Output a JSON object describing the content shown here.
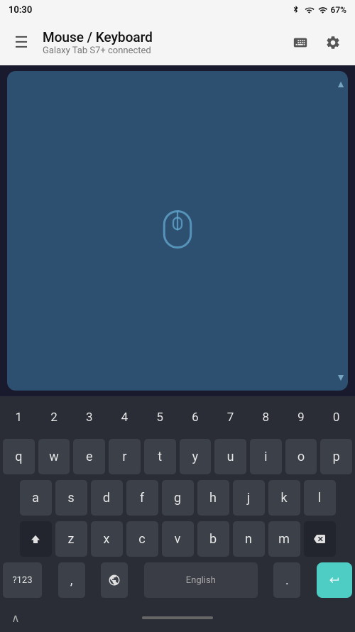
{
  "statusBar": {
    "time": "10:30",
    "battery": "67%"
  },
  "appBar": {
    "title": "Mouse / Keyboard",
    "subtitle": "Galaxy Tab S7+ connected",
    "menuLabel": "☰",
    "keyboardIconLabel": "keyboard",
    "settingsIconLabel": "settings"
  },
  "touchpad": {
    "ariaLabel": "touchpad area"
  },
  "keyboard": {
    "row1": [
      "1",
      "2",
      "3",
      "4",
      "5",
      "6",
      "7",
      "8",
      "9",
      "0"
    ],
    "row2": [
      "q",
      "w",
      "e",
      "r",
      "t",
      "y",
      "u",
      "i",
      "o",
      "p"
    ],
    "row3": [
      "a",
      "s",
      "d",
      "f",
      "g",
      "h",
      "j",
      "k",
      "l"
    ],
    "row4": [
      "z",
      "x",
      "c",
      "v",
      "b",
      "n",
      "m"
    ],
    "bottomRow": {
      "sym": "?123",
      "comma": ",",
      "globe": "🌐",
      "space": "English",
      "period": ".",
      "enter": "↵"
    }
  },
  "navBar": {
    "chevronLabel": "∧",
    "homeIndicator": ""
  }
}
